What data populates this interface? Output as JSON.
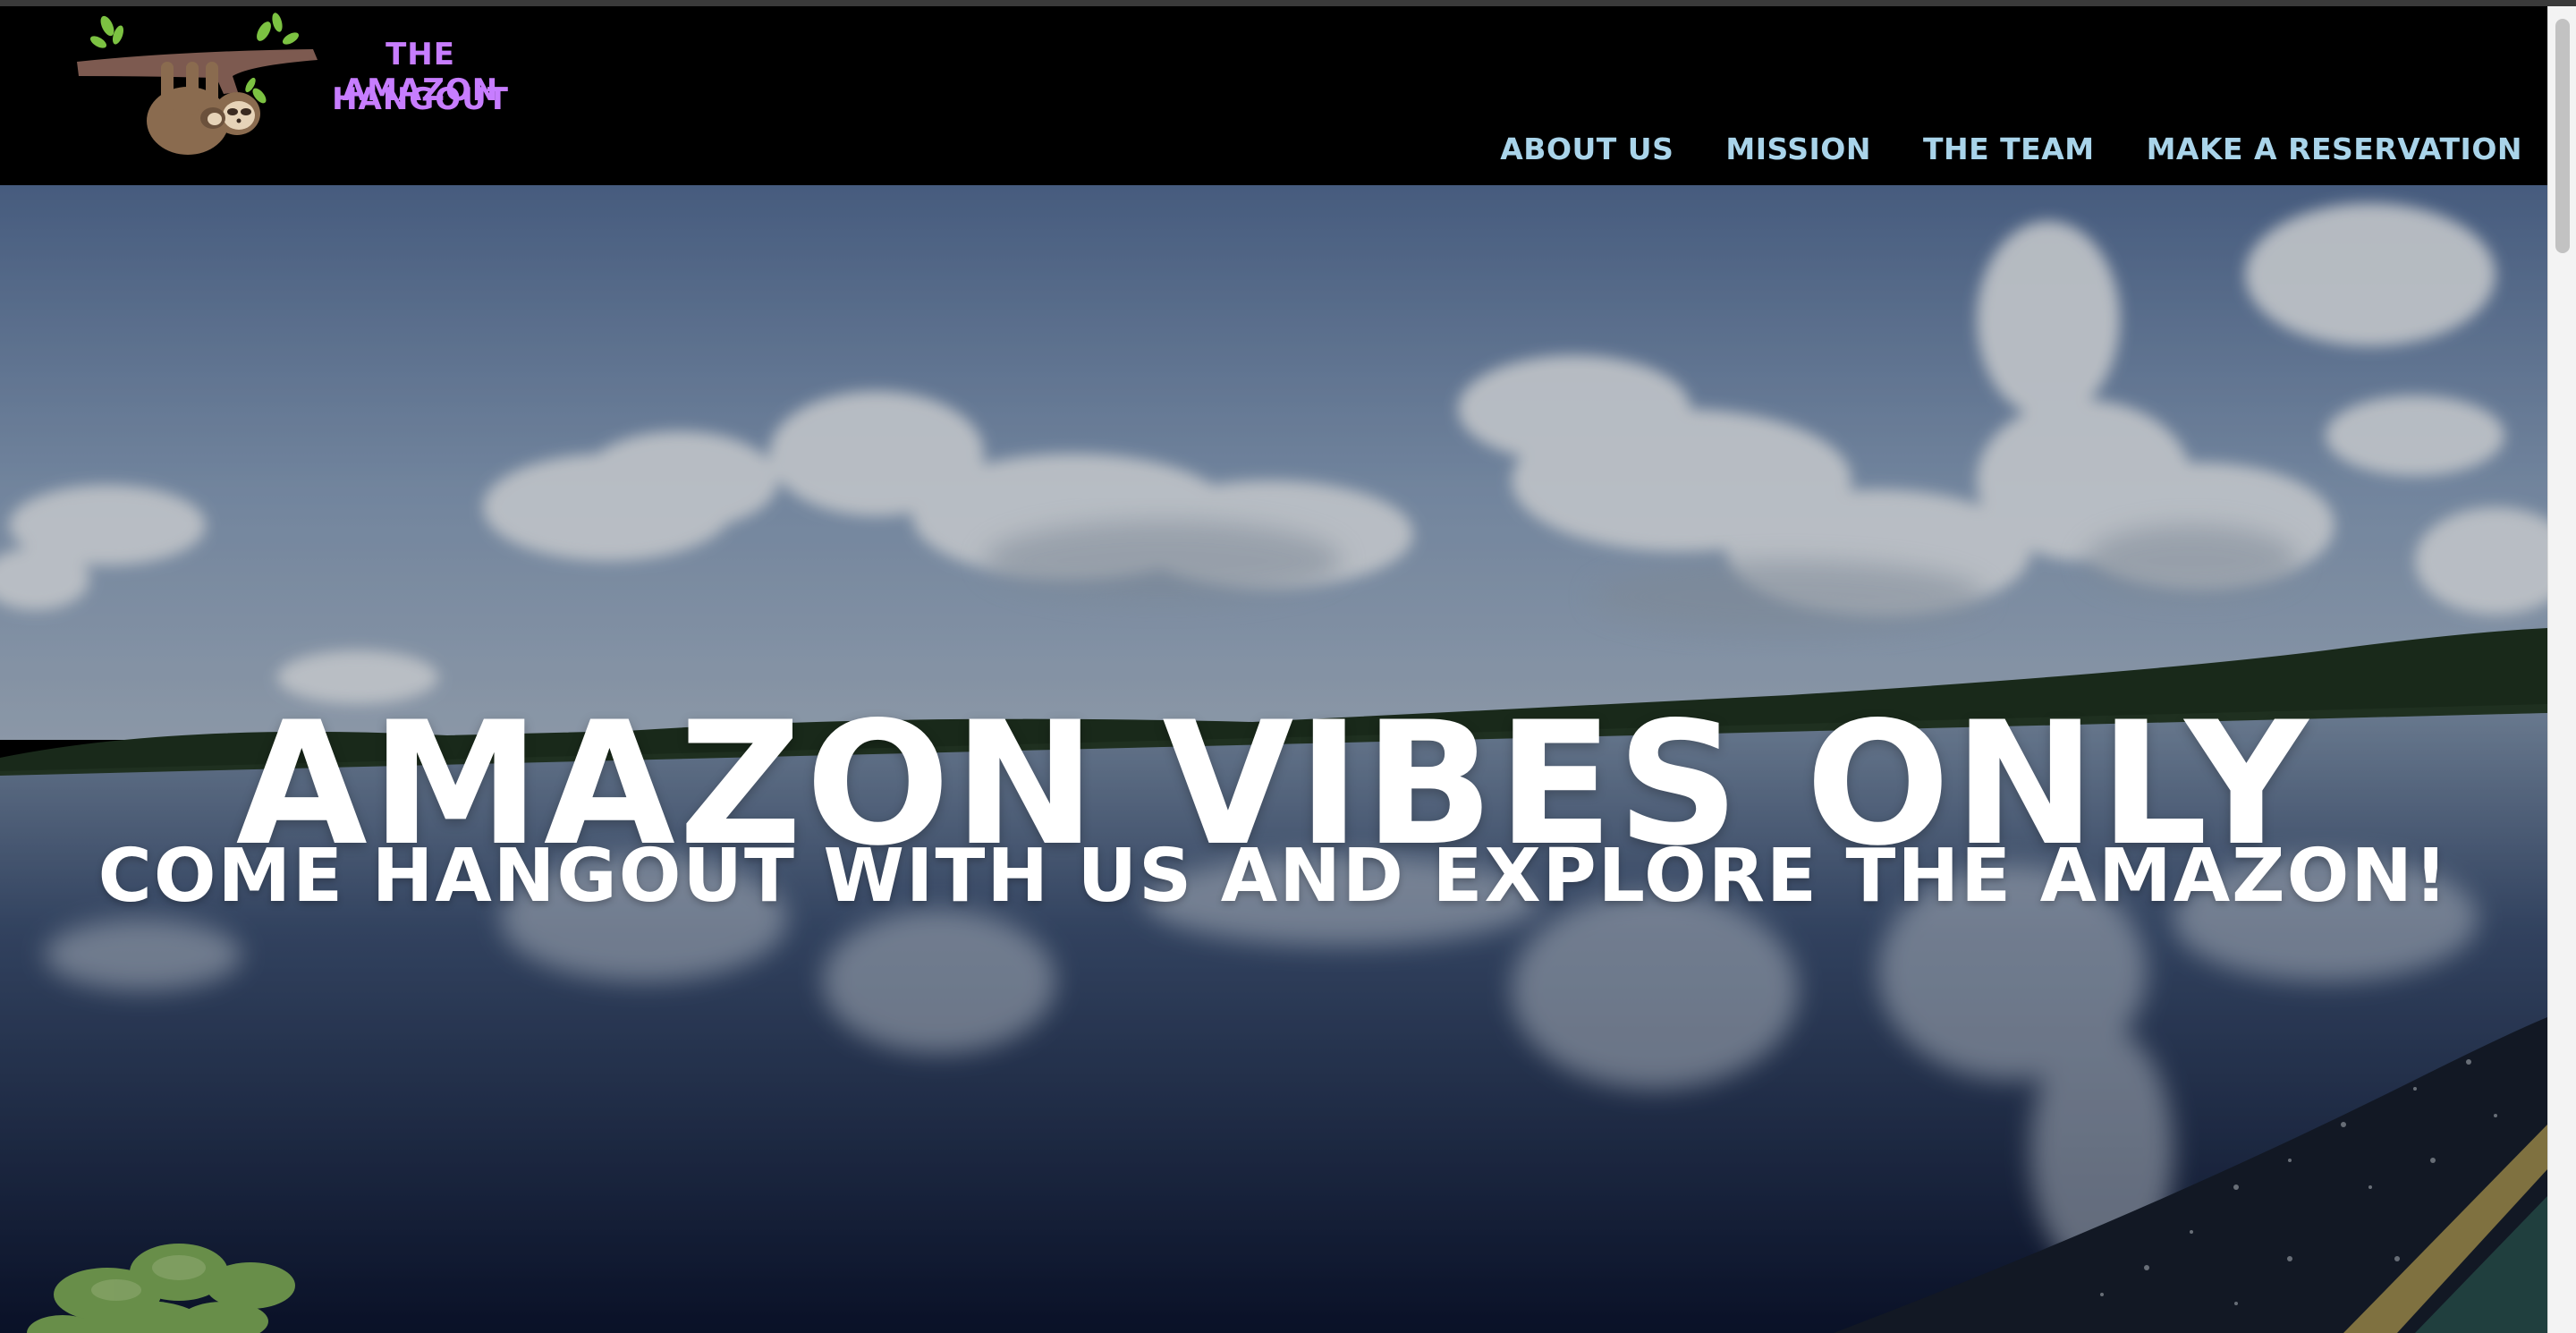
{
  "brand": {
    "line1": "THE AMAZON",
    "line2": "HANGOUT",
    "color": "#c77dff"
  },
  "nav": {
    "items": [
      {
        "label": "ABOUT US"
      },
      {
        "label": "MISSION"
      },
      {
        "label": "THE TEAM"
      },
      {
        "label": "MAKE A RESERVATION"
      }
    ],
    "color": "#a9d4ea"
  },
  "hero": {
    "title": "AMAZON VIBES ONLY",
    "subtitle": "COME HANGOUT WITH US AND EXPLORE THE AMAZON!"
  },
  "icons": {
    "logo": "sloth-on-branch-icon"
  }
}
